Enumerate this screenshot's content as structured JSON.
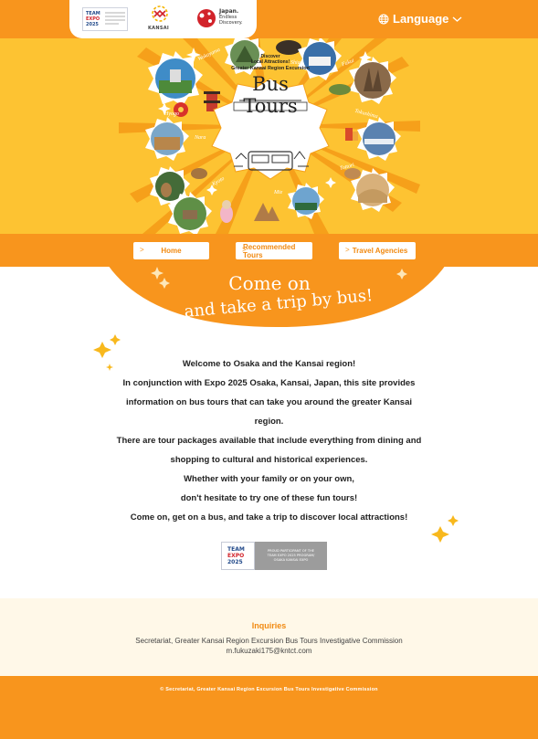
{
  "header": {
    "team_logo": {
      "line1": "TEAM",
      "line2": "EXPO",
      "line3": "2025"
    },
    "kansai_logo": "KANSAI",
    "japan_logo": {
      "line1": "Japan.",
      "line2": "Endless",
      "line3": "Discovery."
    },
    "language_label": "Language"
  },
  "hero": {
    "discover_line1": "Discover",
    "discover_line2": "Local Attractions!",
    "subtitle": "Greater Kansai Region Excursion",
    "title": "Bus Tours",
    "places": [
      "Wakayama",
      "Shiga",
      "Fukui",
      "Hyogo",
      "Tokushima",
      "Nara",
      "Tottori",
      "Kyoto",
      "Mie"
    ]
  },
  "nav": [
    {
      "label": "Home"
    },
    {
      "label": "Recommended Tours"
    },
    {
      "label": "Travel Agencies"
    }
  ],
  "tagline": {
    "line1": "Come on",
    "line2": "and take a trip by bus!"
  },
  "intro": [
    "Welcome to Osaka and the Kansai region!",
    "In conjunction with Expo 2025 Osaka, Kansai, Japan, this site provides",
    "information on bus tours that can take you around the greater Kansai",
    "region.",
    "There are tour packages available that include everything from dining and",
    "shopping to cultural and historical experiences.",
    "Whether with your family or on your own,",
    "don't hesitate to try one of these fun tours!",
    "Come on, get on a bus, and take a trip to discover local attractions!"
  ],
  "badge": {
    "left": {
      "line1": "TEAM",
      "line2": "EXPO",
      "line3": "2025"
    },
    "right": {
      "line1": "PROUD PARTICIPANT OF THE",
      "line2": "TEAM EXPO 2025 PROGRAM/",
      "line3": "OSAKA KANSAI EXPO"
    }
  },
  "inquiries": {
    "heading": "Inquiries",
    "organization": "Secretariat, Greater Kansai Region Excursion Bus Tours Investigative Commission",
    "email": "m.fukuzaki175@kntct.com"
  },
  "footer": {
    "copyright": "© Secretariat, Greater Kansai Region Excursion Bus Tours Investigative Commission"
  },
  "colors": {
    "orange": "#f8951d",
    "yellow": "#fdc332",
    "cream": "#fff8e8"
  }
}
